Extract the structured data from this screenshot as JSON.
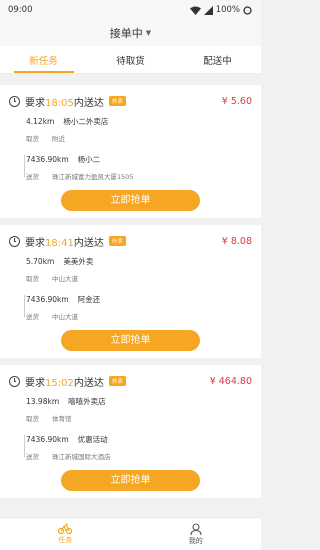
{
  "status_bar": {
    "time": "09:00",
    "battery": "100%"
  },
  "navbar": {
    "title": "接单中"
  },
  "tabs": [
    {
      "label": "新任务",
      "active": true
    },
    {
      "label": "待取货",
      "active": false
    },
    {
      "label": "配送中",
      "active": false
    }
  ],
  "orders": [
    {
      "req_prefix": "要求",
      "time": "18:05",
      "req_suffix": "内送达",
      "tag": "外卖",
      "price": "¥ 5.60",
      "pickup": {
        "distance": "4.12km",
        "name": "杨小二外卖店",
        "label": "取货",
        "address": "附近"
      },
      "delivery": {
        "distance": "7436.90km",
        "name": "杨小二",
        "label": "送货",
        "address": "珠江新城富力盈凯大厦1505"
      },
      "button": "立即抢单"
    },
    {
      "req_prefix": "要求",
      "time": "18:41",
      "req_suffix": "内送达",
      "tag": "外卖",
      "price": "¥ 8.08",
      "pickup": {
        "distance": "5.70km",
        "name": "美美外卖",
        "label": "取货",
        "address": "中山大道"
      },
      "delivery": {
        "distance": "7436.90km",
        "name": "阿金还",
        "label": "送货",
        "address": "中山大道"
      },
      "button": "立即抢单"
    },
    {
      "req_prefix": "要求",
      "time": "15:02",
      "req_suffix": "内送达",
      "tag": "外卖",
      "price": "¥ 464.80",
      "pickup": {
        "distance": "13.98km",
        "name": "嘻嘻外卖店",
        "label": "取货",
        "address": "体育馆"
      },
      "delivery": {
        "distance": "7436.90km",
        "name": "优惠活动",
        "label": "送货",
        "address": "珠江新城国际大酒店"
      },
      "button": "立即抢单"
    }
  ],
  "bottom_nav": [
    {
      "label": "任务",
      "icon": "bike-icon",
      "active": true
    },
    {
      "label": "我的",
      "icon": "user-icon",
      "active": false
    }
  ],
  "colors": {
    "accent": "#f5a623",
    "price": "#e0393e"
  }
}
